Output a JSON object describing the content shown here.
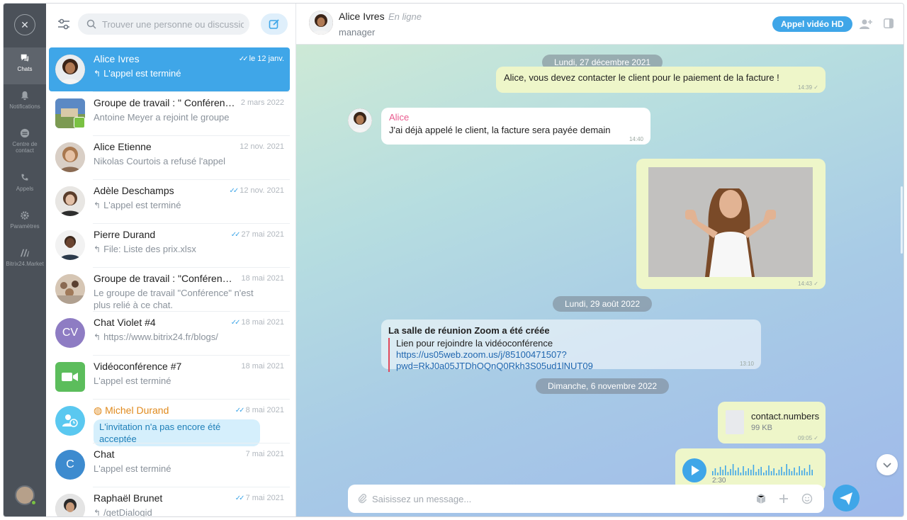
{
  "rail": {
    "items": [
      {
        "label": "Chats",
        "icon": "chat-icon"
      },
      {
        "label": "Notifications",
        "icon": "bell-icon"
      },
      {
        "label": "Centre de contact",
        "icon": "contact-center-icon"
      },
      {
        "label": "Appels",
        "icon": "phone-icon"
      },
      {
        "label": "Paramètres",
        "icon": "gear-icon"
      },
      {
        "label": "Bitrix24.Market",
        "icon": "market-icon"
      }
    ]
  },
  "list": {
    "search_placeholder": "Trouver une personne ou discussion",
    "chats": [
      {
        "name": "Alice Ivres",
        "date": "le 12 janv.",
        "preview": "L'appel est terminé",
        "read": true,
        "reply": true,
        "active": true
      },
      {
        "name": "Groupe de travail : \" Conférence",
        "date": "2 mars 2022",
        "preview": "Antoine Meyer a rejoint le groupe"
      },
      {
        "name": "Alice Etienne",
        "date": "12 nov. 2021",
        "preview": "Nikolas Courtois a refusé l'appel"
      },
      {
        "name": "Adèle Deschamps",
        "date": "12 nov. 2021",
        "preview": "L'appel est terminé",
        "read": true,
        "reply": true
      },
      {
        "name": "Pierre Durand",
        "date": "27 mai 2021",
        "preview": "File: Liste des prix.xlsx",
        "read": true,
        "reply": true
      },
      {
        "name": "Groupe de travail : \"Conférence\"",
        "date": "18 mai 2021",
        "preview": "Le groupe de travail \"Conférence\" n'est plus relié à ce chat."
      },
      {
        "name": "Chat Violet #4",
        "initials": "CV",
        "date": "18 mai 2021",
        "preview": "https://www.bitrix24.fr/blogs/",
        "read": true,
        "reply": true
      },
      {
        "name": "Vidéoconférence #7",
        "date": "18 mai 2021",
        "preview": "L'appel est terminé"
      },
      {
        "name": "Michel Durand",
        "date": "8 mai 2021",
        "preview": "L'invitation n'a pas encore été acceptée",
        "read": true
      },
      {
        "name": "Chat",
        "initials": "C",
        "date": "7 mai 2021",
        "preview": "L'appel est terminé"
      },
      {
        "name": "Raphaël Brunet",
        "date": "7 mai 2021",
        "preview": "/getDialogid",
        "read": true,
        "reply": true
      }
    ]
  },
  "header": {
    "name": "Alice Ivres",
    "status": "En ligne",
    "role": "manager",
    "video_button": "Appel vidéo HD"
  },
  "messages": {
    "date1": "Lundi, 27 décembre 2021",
    "m1_text": "Alice, vous devez contacter le client pour le paiement de la facture !",
    "m1_time": "14:39",
    "m2_sender": "Alice",
    "m2_text": "J'ai déjà appelé le client, la facture sera payée demain",
    "m2_time": "14:40",
    "m3_time": "14:43",
    "date2": "Lundi, 29 août 2022",
    "zoom_title": "La salle de réunion Zoom a été créée",
    "zoom_subtitle": "Lien pour rejoindre la vidéoconférence",
    "zoom_link": "https://us05web.zoom.us/j/85100471507?pwd=RkJ0a05JTDhOQnQ0Rkh3S05ud1lNUT09",
    "zoom_time": "13:10",
    "date3": "Dimanche, 6 novembre 2022",
    "file_name": "contact.numbers",
    "file_size": "99 KB",
    "file_time": "09:05",
    "audio_duration": "2:30"
  },
  "composer": {
    "placeholder": "Saisissez un message..."
  },
  "colors": {
    "accent": "#3fa6e8",
    "rail_bg": "#4b5159",
    "outgoing_bubble": "#eef6c9",
    "sender_name": "#e95a8e",
    "online": "#7ac143"
  }
}
